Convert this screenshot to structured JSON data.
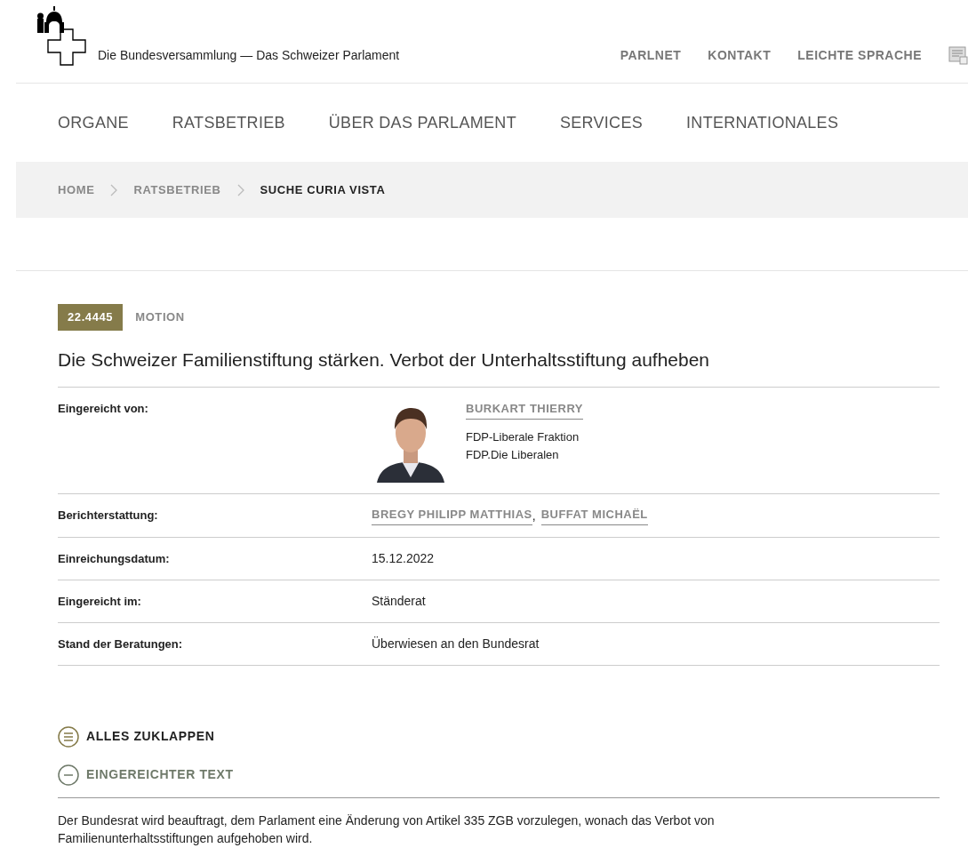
{
  "header": {
    "site_title": "Die Bundesversammlung — Das Schweizer Parlament",
    "links": [
      "PARLNET",
      "KONTAKT",
      "LEICHTE SPRACHE"
    ]
  },
  "nav": {
    "items": [
      "ORGANE",
      "RATSBETRIEB",
      "ÜBER DAS PARLAMENT",
      "SERVICES",
      "INTERNATIONALES"
    ]
  },
  "breadcrumb": [
    {
      "label": "HOME",
      "current": false
    },
    {
      "label": "RATSBETRIEB",
      "current": false
    },
    {
      "label": "SUCHE CURIA VISTA",
      "current": true
    }
  ],
  "business": {
    "number": "22.4445",
    "type": "MOTION",
    "title": "Die Schweizer Familienstiftung stärken. Verbot der Unterhaltsstiftung aufheben"
  },
  "details": [
    {
      "kind": "author",
      "label": "Eingereicht von:",
      "name": "BURKART THIERRY",
      "lines": [
        "FDP-Liberale Fraktion",
        "FDP.Die Liberalen"
      ],
      "photo": {
        "kind": "picture"
      }
    },
    {
      "kind": "links",
      "label": "Berichterstattung:",
      "links": [
        "BREGY PHILIPP MATTHIAS",
        "BUFFAT MICHAËL"
      ],
      "separator": ","
    },
    {
      "kind": "text",
      "label": "Einreichungsdatum:",
      "value": "15.12.2022"
    },
    {
      "kind": "text",
      "label": "Eingereicht im:",
      "value": "Ständerat"
    },
    {
      "kind": "text",
      "label": "Stand der Beratungen:",
      "value": "Überwiesen an den Bundesrat"
    }
  ],
  "collapse_all": "ALLES ZUKLAPPEN",
  "sections": [
    {
      "title": "EINGEREICHTER TEXT",
      "expanded": true,
      "text": "Der Bundesrat wird beauftragt, dem Parlament eine Änderung von Artikel 335 ZGB vorzulegen, wonach das Verbot von Familienunterhaltsstiftungen aufgehoben wird."
    }
  ]
}
